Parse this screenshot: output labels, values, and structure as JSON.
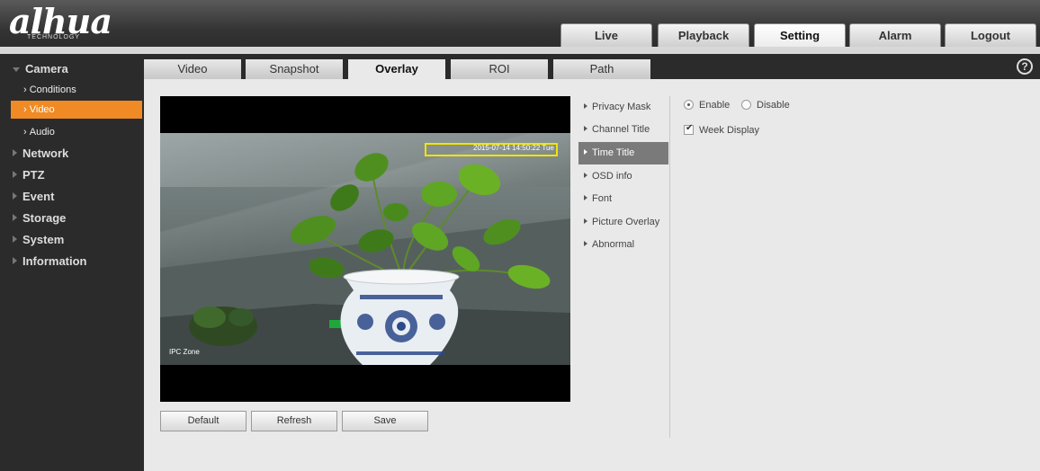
{
  "header": {
    "logo": "alhua",
    "logo_sub": "TECHNOLOGY",
    "tabs": [
      {
        "label": "Live",
        "active": false
      },
      {
        "label": "Playback",
        "active": false
      },
      {
        "label": "Setting",
        "active": true
      },
      {
        "label": "Alarm",
        "active": false
      },
      {
        "label": "Logout",
        "active": false
      }
    ]
  },
  "sidebar": {
    "items": [
      {
        "label": "Camera",
        "expanded": true
      },
      {
        "label": "Conditions"
      },
      {
        "label": "Video",
        "active": true
      },
      {
        "label": "Audio"
      },
      {
        "label": "Network"
      },
      {
        "label": "PTZ"
      },
      {
        "label": "Event"
      },
      {
        "label": "Storage"
      },
      {
        "label": "System"
      },
      {
        "label": "Information"
      }
    ]
  },
  "subtabs": [
    {
      "label": "Video"
    },
    {
      "label": "Snapshot"
    },
    {
      "label": "Overlay",
      "active": true
    },
    {
      "label": "ROI"
    },
    {
      "label": "Path"
    }
  ],
  "help_icon": "?",
  "preview": {
    "time_title": "2015-07-14 14:50:22 Tue",
    "channel_title": "IPC Zone"
  },
  "overlay_menu": [
    {
      "label": "Privacy Mask"
    },
    {
      "label": "Channel Title"
    },
    {
      "label": "Time Title",
      "active": true
    },
    {
      "label": "OSD info"
    },
    {
      "label": "Font"
    },
    {
      "label": "Picture Overlay"
    },
    {
      "label": "Abnormal"
    }
  ],
  "options": {
    "enable_label": "Enable",
    "disable_label": "Disable",
    "week_display_label": "Week Display",
    "selected": "Enable",
    "week_display_checked": true
  },
  "buttons": {
    "default": "Default",
    "refresh": "Refresh",
    "save": "Save"
  },
  "colors": {
    "accent": "#f08a24",
    "title_box": "#f3e300",
    "dark_bg": "#2b2b2b"
  }
}
